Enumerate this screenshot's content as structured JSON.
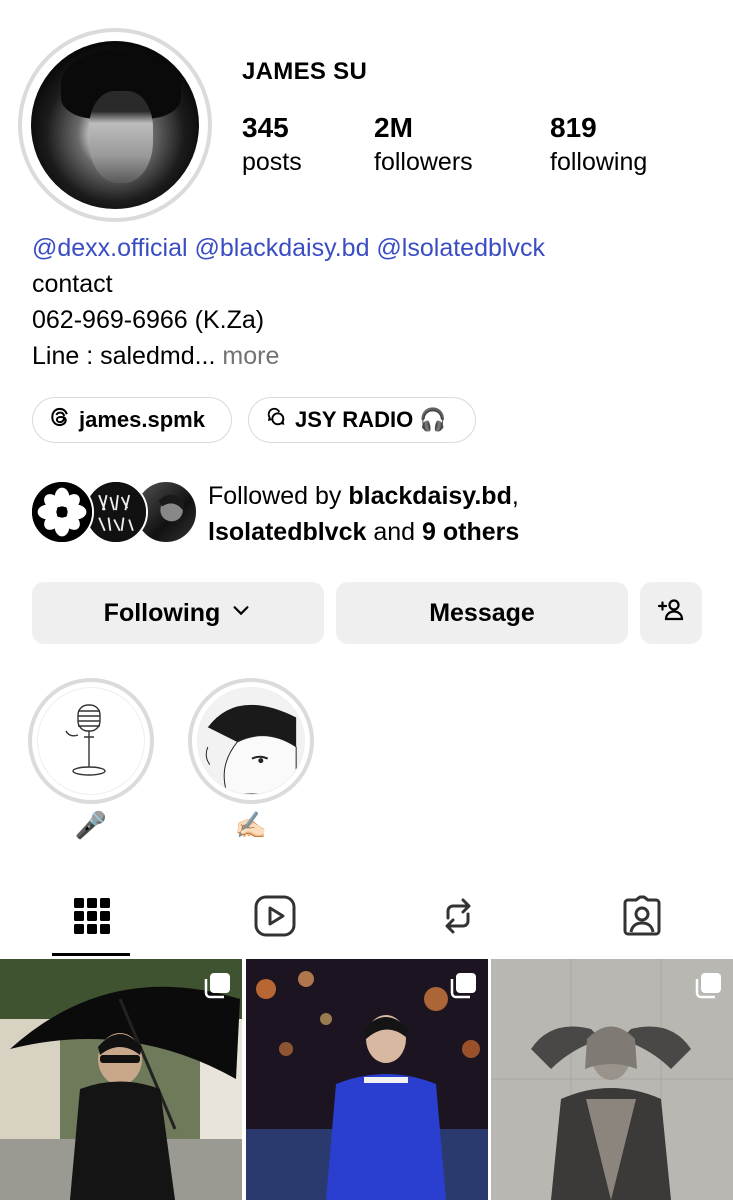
{
  "profile": {
    "username": "JAMES SU",
    "stats": [
      {
        "value": "345",
        "label": "posts"
      },
      {
        "value": "2M",
        "label": "followers"
      },
      {
        "value": "819",
        "label": "following"
      }
    ]
  },
  "bio": {
    "mentions": "@dexx.official @blackdaisy.bd @lsolatedblvck",
    "line2": "contact",
    "line3": "062-969-6966 (K.Za)",
    "line4": "Line : saledmd...",
    "more": " more"
  },
  "links": [
    {
      "label": "james.spmk",
      "icon": "threads-icon"
    },
    {
      "label": "JSY RADIO 🎧",
      "icon": "chat-icon"
    }
  ],
  "followed_by": {
    "prefix": "Followed by ",
    "user1": "blackdaisy.bd",
    "sep": ",",
    "user2": "lsolatedblvck",
    "mid": " and ",
    "others": "9 others"
  },
  "actions": {
    "following": "Following",
    "message": "Message"
  },
  "highlights": [
    {
      "label": "🎤"
    },
    {
      "label": "✍🏻"
    }
  ],
  "tabs": [
    "grid-icon",
    "reels-icon",
    "reposts-icon",
    "tagged-icon"
  ]
}
